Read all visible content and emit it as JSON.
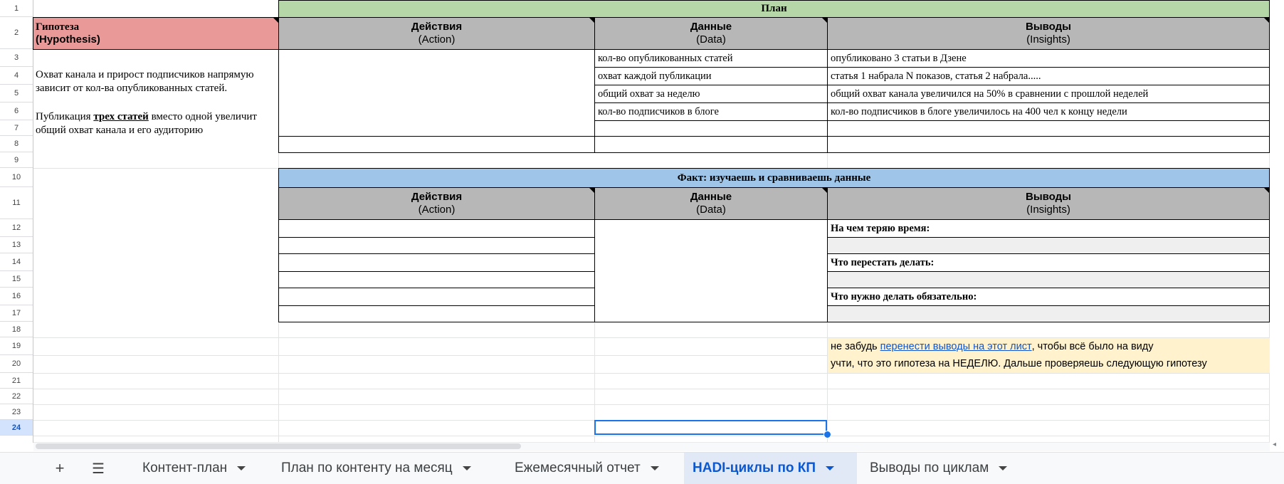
{
  "rows": [
    "1",
    "2",
    "3",
    "4",
    "5",
    "6",
    "7",
    "8",
    "9",
    "10",
    "11",
    "12",
    "13",
    "14",
    "15",
    "16",
    "17",
    "18",
    "19",
    "20",
    "21",
    "22",
    "23",
    "24"
  ],
  "plan": {
    "title": "План",
    "hypothesis_title": "Гипотеза",
    "hypothesis_sub": "(Hypothesis)",
    "action_title": "Действия",
    "action_sub": "(Action)",
    "data_title": "Данные",
    "data_sub": "(Data)",
    "insights_title": "Выводы",
    "insights_sub": "(Insights)",
    "hypothesis_p1": "Охват канала и прирост подписчиков напрямую зависит от кол-ва опубликованных статей.",
    "hypothesis_p2_before": "Публикация ",
    "hypothesis_p2_bold": "трех статей",
    "hypothesis_p2_after": " вместо одной увеличит общий охват канала и его аудиторию",
    "data_rows": [
      "кол-во опубликованных статей",
      "охват каждой публикации",
      "общий охват за неделю",
      "кол-во подписчиков в блоге"
    ],
    "insight_rows": [
      "опубликовано 3 статьи в Дзене",
      "статья 1 набрала N показов, статья 2 набрала.....",
      "общий охват канала увеличился на 50% в сравнении с прошлой неделей",
      "кол-во подписчиков в блоге увеличилось на 400 чел к концу недели"
    ]
  },
  "fact": {
    "title": "Факт: изучаешь и сравниваешь данные",
    "action_title": "Действия",
    "action_sub": "(Action)",
    "data_title": "Данные",
    "data_sub": "(Data)",
    "insights_title": "Выводы",
    "insights_sub": "(Insights)",
    "q1": "На чем теряю время:",
    "q2": "Что перестать делать:",
    "q3": "Что нужно делать обязательно:"
  },
  "notes": {
    "line1_before": "не забудь ",
    "line1_link": "перенести выводы на этот лист",
    "line1_after": ", чтобы всё было на виду",
    "line2": "учти, что это гипотеза на НЕДЕЛЮ. Дальше проверяешь следующую гипотезу"
  },
  "tabs": [
    {
      "label": "Контент-план",
      "active": false
    },
    {
      "label": "План по контенту на месяц",
      "active": false
    },
    {
      "label": "Ежемесячный отчет",
      "active": false
    },
    {
      "label": "HADI-циклы по КП",
      "active": true
    },
    {
      "label": "Выводы по циклам",
      "active": false
    }
  ],
  "toolbar": {
    "add_icon": "plus-icon",
    "menu_icon": "menu-icon"
  },
  "selected_row": "24"
}
